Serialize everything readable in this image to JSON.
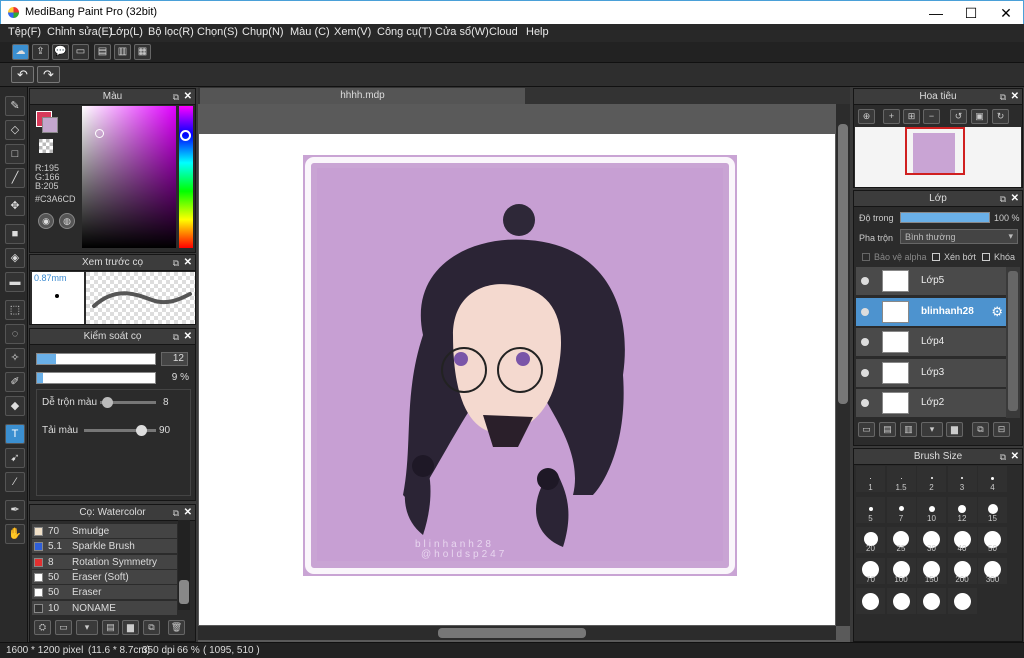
{
  "window": {
    "title": "MediBang Paint Pro (32bit)",
    "minimize": "—",
    "maximize": "☐",
    "close": "✕"
  },
  "menu": [
    "Tệp(F)",
    "Chỉnh sửa(E)",
    "Lớp(L)",
    "Bộ lọc(R)",
    "Chọn(S)",
    "Chụp(N)",
    "Màu (C)",
    "Xem(V)",
    "Công cụ(T)",
    "Cửa sổ(W)",
    "Cloud",
    "Help"
  ],
  "doc_tab": "hhhh.mdp",
  "color_panel": {
    "title": "Màu",
    "r": "R:195",
    "g": "G:166",
    "b": "B:205",
    "hex": "#C3A6CD",
    "accent": "#C3A6CD"
  },
  "brush_preview": {
    "title": "Xem trước cọ",
    "size": "0.87mm"
  },
  "brush_control": {
    "title": "Kiểm soát cọ",
    "size_value": "12",
    "opacity_value": "9 %",
    "size_fraction": 0.16,
    "opacity_fraction": 0.05,
    "blend_label": "Dễ trộn màu",
    "blend_value": "8",
    "color_amount_label": "Tải màu",
    "color_amount_value": "90"
  },
  "brush_list": {
    "title": "Cọ: Watercolor",
    "items": [
      {
        "size": "70",
        "name": "Smudge",
        "color": "#f0e0c8"
      },
      {
        "size": "5.1",
        "name": "Sparkle Brush",
        "color": "#2f5fd8"
      },
      {
        "size": "8",
        "name": "Rotation Symmetry Pen",
        "color": "#e23030"
      },
      {
        "size": "50",
        "name": "Eraser (Soft)",
        "color": "#ffffff"
      },
      {
        "size": "50",
        "name": "Eraser",
        "color": "#ffffff"
      },
      {
        "size": "10",
        "name": "NONAME",
        "color": "#333333"
      }
    ]
  },
  "navigator": {
    "title": "Hoa tiêu"
  },
  "layers": {
    "title": "Lớp",
    "opacity_label": "Độ trong",
    "opacity_value": "100 %",
    "opacity_fraction": 1.0,
    "blend_label": "Pha trộn",
    "blend_value": "Bình thường",
    "protect_alpha": "Bảo vệ alpha",
    "clip": "Xén bớt",
    "lock": "Khóa",
    "items": [
      {
        "name": "Lớp5",
        "selected": false
      },
      {
        "name": "blinhanh28",
        "selected": true
      },
      {
        "name": "Lớp4",
        "selected": false
      },
      {
        "name": "Lớp3",
        "selected": false
      },
      {
        "name": "Lớp2",
        "selected": false
      }
    ]
  },
  "brush_size": {
    "title": "Brush Size",
    "sizes": [
      "1",
      "1.5",
      "2",
      "3",
      "4",
      "5",
      "7",
      "10",
      "12",
      "15",
      "20",
      "25",
      "30",
      "40",
      "50",
      "70",
      "100",
      "150",
      "200",
      "300",
      "",
      "",
      "",
      ""
    ]
  },
  "artwork": {
    "watermark_line1": "blinhanh28",
    "watermark_line2": "@holdsp247",
    "background": "#c9a4d4"
  },
  "status": {
    "dimensions": "1600 * 1200 pixel",
    "physical": "(11.6 * 8.7cm)",
    "dpi": "350 dpi",
    "zoom": "66 %",
    "coords": "( 1095, 510 )"
  }
}
